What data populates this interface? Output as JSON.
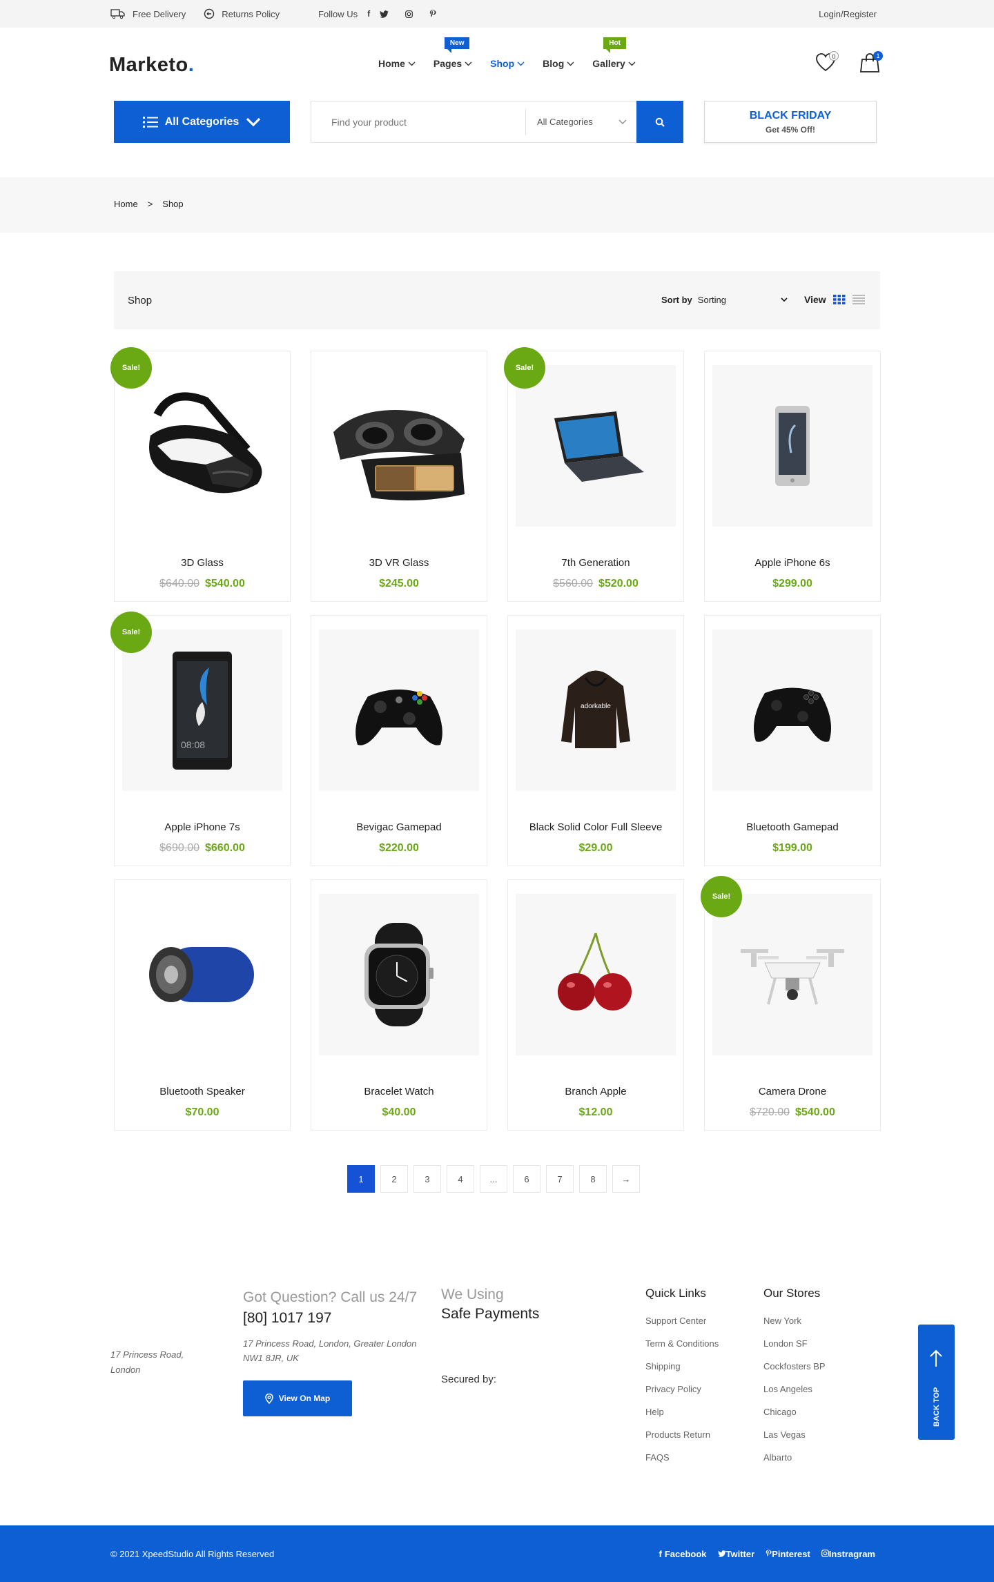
{
  "topbar": {
    "delivery": "Free Delivery",
    "returns": "Returns Policy",
    "follow": "Follow Us",
    "social_icons": [
      "facebook-icon",
      "twitter-icon",
      "instagram-icon",
      "pinterest-icon"
    ],
    "login": "Login/Register"
  },
  "header": {
    "logo": "Marketo",
    "logo_dot": ".",
    "nav": [
      {
        "label": "Home"
      },
      {
        "label": "Pages",
        "tag": "New"
      },
      {
        "label": "Shop"
      },
      {
        "label": "Blog"
      },
      {
        "label": "Gallery",
        "tag": "Hot"
      }
    ],
    "wishlist_count": "0",
    "cart_count": "1"
  },
  "search": {
    "categories_button": "All Categories",
    "placeholder": "Find your product",
    "category_select": "All Categories",
    "promo_title": "BLACK FRIDAY",
    "promo_sub": "Get 45% Off!"
  },
  "breadcrumb": {
    "home": "Home",
    "sep": ">",
    "current": "Shop"
  },
  "shop": {
    "title": "Shop",
    "sort_label": "Sort by",
    "sort_value": "Sorting",
    "view_label": "View"
  },
  "products": [
    {
      "name": "3D Glass",
      "old": "$640.00",
      "price": "$540.00",
      "sale": "Sale!"
    },
    {
      "name": "3D VR Glass",
      "old": "",
      "price": "$245.00",
      "sale": ""
    },
    {
      "name": "7th Generation",
      "old": "$560.00",
      "price": "$520.00",
      "sale": "Sale!"
    },
    {
      "name": "Apple iPhone 6s",
      "old": "",
      "price": "$299.00",
      "sale": ""
    },
    {
      "name": "Apple iPhone 7s",
      "old": "$690.00",
      "price": "$660.00",
      "sale": "Sale!"
    },
    {
      "name": "Bevigac Gamepad",
      "old": "",
      "price": "$220.00",
      "sale": ""
    },
    {
      "name": "Black Solid Color Full Sleeve",
      "old": "",
      "price": "$29.00",
      "sale": ""
    },
    {
      "name": "Bluetooth Gamepad",
      "old": "",
      "price": "$199.00",
      "sale": ""
    },
    {
      "name": "Bluetooth Speaker",
      "old": "",
      "price": "$70.00",
      "sale": ""
    },
    {
      "name": "Bracelet Watch",
      "old": "",
      "price": "$40.00",
      "sale": ""
    },
    {
      "name": "Branch Apple",
      "old": "",
      "price": "$12.00",
      "sale": ""
    },
    {
      "name": "Camera Drone",
      "old": "$720.00",
      "price": "$540.00",
      "sale": "Sale!"
    }
  ],
  "hoodie_print": "adorkable",
  "phone_clock": "08:08",
  "pagination": [
    "1",
    "2",
    "3",
    "4",
    "...",
    "6",
    "7",
    "8",
    "→"
  ],
  "footer": {
    "address_left": "17 Princess Road, London",
    "question": "Got Question? Call us 24/7",
    "phone": "[80] 1017 197",
    "address": "17 Princess Road, London, Greater London NW1 8JR, UK",
    "map_button": "View On Map",
    "we_using": "We Using",
    "safe_payments": "Safe Payments",
    "secured_by": "Secured by:",
    "quick_links_title": "Quick Links",
    "quick_links": [
      "Support Center",
      "Term & Conditions",
      "Shipping",
      "Privacy Policy",
      "Help",
      "Products Return",
      "FAQS"
    ],
    "stores_title": "Our Stores",
    "stores": [
      "New York",
      "London SF",
      "Cockfosters BP",
      "Los Angeles",
      "Chicago",
      "Las Vegas",
      "Albarto"
    ],
    "back_top": "BACK TOP",
    "copyright": "© 2021 XpeedStudio All Rights Reserved",
    "social": [
      "Facebook",
      "Twitter",
      "Pinterest",
      "Instragram"
    ]
  },
  "colors": {
    "brand": "#0f5fd4",
    "sale": "#6aa913"
  }
}
